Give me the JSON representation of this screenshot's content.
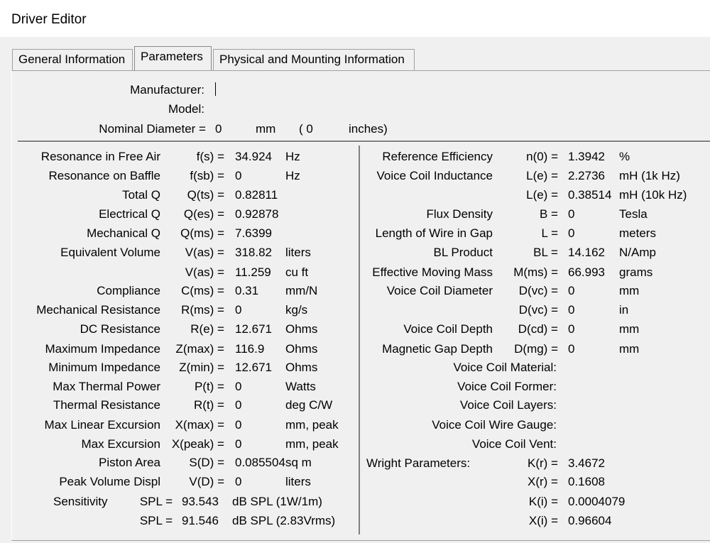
{
  "window": {
    "title": "Driver Editor"
  },
  "tabs": [
    {
      "label": "General Information"
    },
    {
      "label": "Parameters"
    },
    {
      "label": "Physical and Mounting Information"
    }
  ],
  "header": {
    "manufacturer_label": "Manufacturer:",
    "manufacturer_value": "",
    "model_label": "Model:",
    "model_value": "",
    "nominal_label": "Nominal Diameter =",
    "nominal_mm_value": "0",
    "nominal_mm_unit": "mm",
    "nominal_in_open": "( 0",
    "nominal_in_unit": "inches)"
  },
  "left_params": [
    {
      "name": "Resonance in Free Air",
      "sym": "f(s) =",
      "value": "34.924",
      "unit": "Hz"
    },
    {
      "name": "Resonance on Baffle",
      "sym": "f(sb) =",
      "value": "0",
      "unit": "Hz"
    },
    {
      "name": "Total Q",
      "sym": "Q(ts) =",
      "value": "0.82811",
      "unit": ""
    },
    {
      "name": "Electrical Q",
      "sym": "Q(es) =",
      "value": "0.92878",
      "unit": ""
    },
    {
      "name": "Mechanical Q",
      "sym": "Q(ms) =",
      "value": "7.6399",
      "unit": ""
    },
    {
      "name": "Equivalent Volume",
      "sym": "V(as) =",
      "value": "318.82",
      "unit": "liters"
    },
    {
      "name": "",
      "sym": "V(as) =",
      "value": "11.259",
      "unit": "cu ft"
    },
    {
      "name": "Compliance",
      "sym": "C(ms) =",
      "value": "0.31",
      "unit": "mm/N"
    },
    {
      "name": "Mechanical Resistance",
      "sym": "R(ms) =",
      "value": "0",
      "unit": "kg/s"
    },
    {
      "name": "DC Resistance",
      "sym": "R(e) =",
      "value": "12.671",
      "unit": "Ohms"
    },
    {
      "name": "Maximum Impedance",
      "sym": "Z(max) =",
      "value": "116.9",
      "unit": "Ohms"
    },
    {
      "name": "Minimum Impedance",
      "sym": "Z(min) =",
      "value": "12.671",
      "unit": "Ohms"
    },
    {
      "name": "Max Thermal Power",
      "sym": "P(t) =",
      "value": "0",
      "unit": "Watts"
    },
    {
      "name": "Thermal Resistance",
      "sym": "R(t) =",
      "value": "0",
      "unit": "deg C/W"
    },
    {
      "name": "Max Linear Excursion",
      "sym": "X(max) =",
      "value": "0",
      "unit": "mm, peak"
    },
    {
      "name": "Max Excursion",
      "sym": "X(peak) =",
      "value": "0",
      "unit": "mm, peak"
    },
    {
      "name": "Piston Area",
      "sym": "S(D) =",
      "value": "0.085504",
      "unit": "sq m"
    },
    {
      "name": "Peak Volume Displ",
      "sym": "V(D) =",
      "value": "0",
      "unit": "liters"
    }
  ],
  "sensitivity": {
    "label": "Sensitivity",
    "rows": [
      {
        "sym": "SPL =",
        "value": "93.543",
        "unit": "dB SPL (1W/1m)"
      },
      {
        "sym": "SPL =",
        "value": "91.546",
        "unit": "dB SPL (2.83Vrms)"
      }
    ]
  },
  "right_params": [
    {
      "name": "Reference Efficiency",
      "sym": "n(0) =",
      "value": "1.3942",
      "unit": "%"
    },
    {
      "name": "Voice Coil Inductance",
      "sym": "L(e) =",
      "value": "2.2736",
      "unit": "mH (1k Hz)"
    },
    {
      "name": "",
      "sym": "L(e) =",
      "value": "0.38514",
      "unit": "mH (10k Hz)"
    },
    {
      "name": "Flux Density",
      "sym": "B =",
      "value": "0",
      "unit": "Tesla"
    },
    {
      "name": "Length of Wire in Gap",
      "sym": "L =",
      "value": "0",
      "unit": "meters"
    },
    {
      "name": "BL Product",
      "sym": "BL =",
      "value": "14.162",
      "unit": "N/Amp"
    },
    {
      "name": "Effective Moving Mass",
      "sym": "M(ms) =",
      "value": "66.993",
      "unit": "grams"
    },
    {
      "name": "Voice Coil Diameter",
      "sym": "D(vc) =",
      "value": "0",
      "unit": "mm"
    },
    {
      "name": "",
      "sym": "D(vc) =",
      "value": "0",
      "unit": "in"
    },
    {
      "name": "Voice Coil Depth",
      "sym": "D(cd) =",
      "value": "0",
      "unit": "mm"
    },
    {
      "name": "Magnetic Gap Depth",
      "sym": "D(mg) =",
      "value": "0",
      "unit": "mm"
    }
  ],
  "coil_info": [
    {
      "label": "Voice Coil Material:"
    },
    {
      "label": "Voice Coil Former:"
    },
    {
      "label": "Voice Coil Layers:"
    },
    {
      "label": "Voice Coil Wire Gauge:"
    },
    {
      "label": "Voice Coil Vent:"
    }
  ],
  "wright": {
    "label": "Wright Parameters:",
    "rows": [
      {
        "sym": "K(r) =",
        "value": "3.4672"
      },
      {
        "sym": "X(r) =",
        "value": "0.1608"
      },
      {
        "sym": "K(i) =",
        "value": "0.0004079"
      },
      {
        "sym": "X(i) =",
        "value": "0.96604"
      }
    ]
  }
}
